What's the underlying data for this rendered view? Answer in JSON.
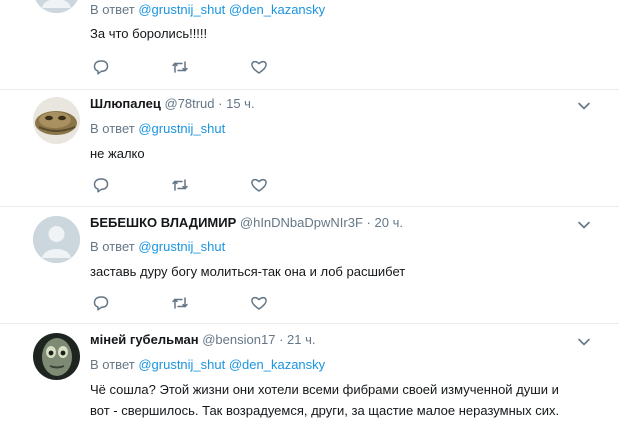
{
  "tweets": [
    {
      "reply_prefix": "В ответ",
      "mentions": [
        "@grustnij_shut",
        "@den_kazansky"
      ],
      "text": "За что боролись!!!!!"
    },
    {
      "name": "Шлюпалец",
      "handle": "@78trud",
      "dot": "·",
      "time": "15 ч.",
      "reply_prefix": "В ответ",
      "mentions": [
        "@grustnij_shut"
      ],
      "text": "не жалко"
    },
    {
      "name": "БЕБЕШКО ВЛАДИМИР",
      "handle": "@hInDNbaDpwNIr3F",
      "dot": "·",
      "time": "20 ч.",
      "reply_prefix": "В ответ",
      "mentions": [
        "@grustnij_shut"
      ],
      "text": "заставь дуру богу молиться-так она и лоб расшибет"
    },
    {
      "name": "міней губельман",
      "handle": "@bension17",
      "dot": "·",
      "time": "21 ч.",
      "reply_prefix": "В ответ",
      "mentions": [
        "@grustnij_shut",
        "@den_kazansky"
      ],
      "text_lines": [
        "Чё сошла? Этой жизни они хотели всеми фибрами своей измученной души и",
        "вот - свершилось. Так возрадуемся, други, за щастие малое неразумных сих."
      ]
    }
  ],
  "icons": {
    "reply": "reply-icon",
    "retweet": "retweet-icon",
    "like": "heart-icon",
    "caret": "chevron-down-icon"
  },
  "colors": {
    "link": "#1b95e0",
    "secondary_text": "#657786",
    "primary_text": "#14171a",
    "icon": "#657786",
    "divider": "#e6ecf0"
  }
}
